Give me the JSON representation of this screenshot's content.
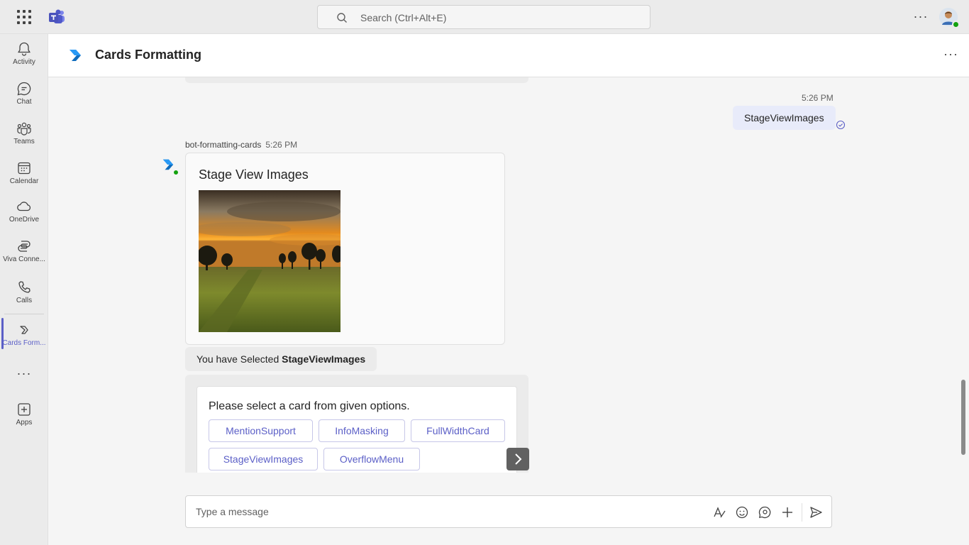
{
  "topbar": {
    "search_placeholder": "Search (Ctrl+Alt+E)"
  },
  "rail": {
    "items": [
      {
        "label": "Activity",
        "icon": "bell-icon"
      },
      {
        "label": "Chat",
        "icon": "chat-icon"
      },
      {
        "label": "Teams",
        "icon": "teams-icon"
      },
      {
        "label": "Calendar",
        "icon": "calendar-icon"
      },
      {
        "label": "OneDrive",
        "icon": "cloud-icon"
      },
      {
        "label": "Viva Conne...",
        "icon": "viva-connections-icon"
      },
      {
        "label": "Calls",
        "icon": "phone-icon"
      },
      {
        "label": "Cards Form...",
        "icon": "cards-formatting-app-icon"
      },
      {
        "label": "Apps",
        "icon": "add-app-icon"
      }
    ]
  },
  "header": {
    "title": "Cards Formatting"
  },
  "messages": {
    "my_time": "5:26 PM",
    "my_text": "StageViewImages",
    "bot_name": "bot-formatting-cards",
    "bot_time": "5:26 PM",
    "card1_title": "Stage View Images",
    "selected_prefix": "You have Selected ",
    "selected_value": "StageViewImages",
    "card2_title": "Please select a card from given options.",
    "options": [
      "MentionSupport",
      "InfoMasking",
      "FullWidthCard",
      "StageViewImages",
      "OverflowMenu"
    ]
  },
  "composer": {
    "placeholder": "Type a message"
  },
  "colors": {
    "accent": "#5b5fc7",
    "presence_available": "#13a10e",
    "my_bubble": "#e8ebfa"
  }
}
